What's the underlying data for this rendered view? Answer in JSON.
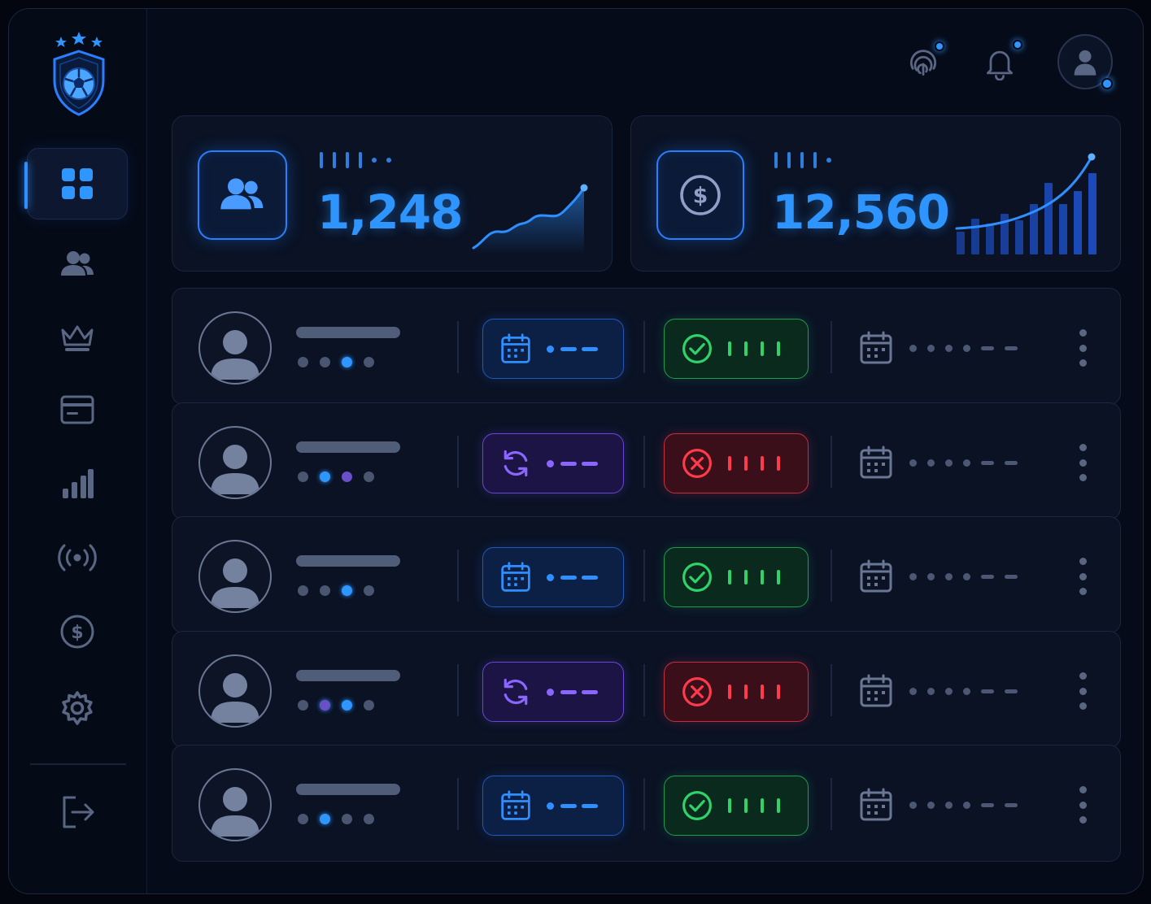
{
  "sidebar": {
    "logo": "football-shield-logo",
    "items": [
      {
        "icon": "dashboard-grid-icon",
        "active": true
      },
      {
        "icon": "users-icon",
        "active": false
      },
      {
        "icon": "crown-icon",
        "active": false
      },
      {
        "icon": "card-icon",
        "active": false
      },
      {
        "icon": "bar-chart-icon",
        "active": false
      },
      {
        "icon": "broadcast-icon",
        "active": false
      },
      {
        "icon": "dollar-icon",
        "active": false
      },
      {
        "icon": "settings-icon",
        "active": false
      }
    ],
    "logout_icon": "logout-icon"
  },
  "topbar": {
    "icons": [
      "fingerprint-icon",
      "bell-icon",
      "profile-avatar-icon"
    ]
  },
  "stats": [
    {
      "icon": "users-icon",
      "value": "1,248",
      "chart": "line-area"
    },
    {
      "icon": "dollar-icon",
      "value": "12,560",
      "chart": "bars-with-line"
    }
  ],
  "rows": [
    {
      "type": "calendar",
      "type_color": "#2f8fff",
      "status": "active",
      "avatar_dot": 2
    },
    {
      "type": "renew",
      "type_color": "#8a66ff",
      "status": "failed",
      "avatar_dot": 1
    },
    {
      "type": "calendar",
      "type_color": "#2f8fff",
      "status": "active",
      "avatar_dot": 2
    },
    {
      "type": "renew",
      "type_color": "#8a66ff",
      "status": "failed",
      "avatar_dot": 1
    },
    {
      "type": "calendar",
      "type_color": "#2f8fff",
      "status": "active",
      "avatar_dot": 1
    }
  ],
  "colors": {
    "accent": "#2f8fff",
    "purple": "#8a66ff",
    "success": "#2fd36a",
    "danger": "#ff3a4a",
    "muted": "#4b5773"
  }
}
